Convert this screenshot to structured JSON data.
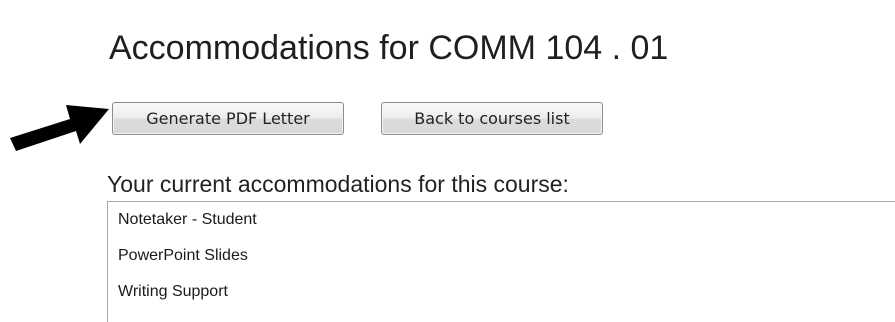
{
  "page": {
    "title": "Accommodations for COMM 104 . 01"
  },
  "actions": {
    "generate_pdf_label": "Generate PDF Letter",
    "back_label": "Back to courses list"
  },
  "pointer": {
    "icon": "arrow-right-icon",
    "color": "#000000"
  },
  "accommodations": {
    "heading": "Your current accommodations for this course:",
    "items": [
      "Notetaker - Student",
      "PowerPoint Slides",
      "Writing Support"
    ]
  }
}
